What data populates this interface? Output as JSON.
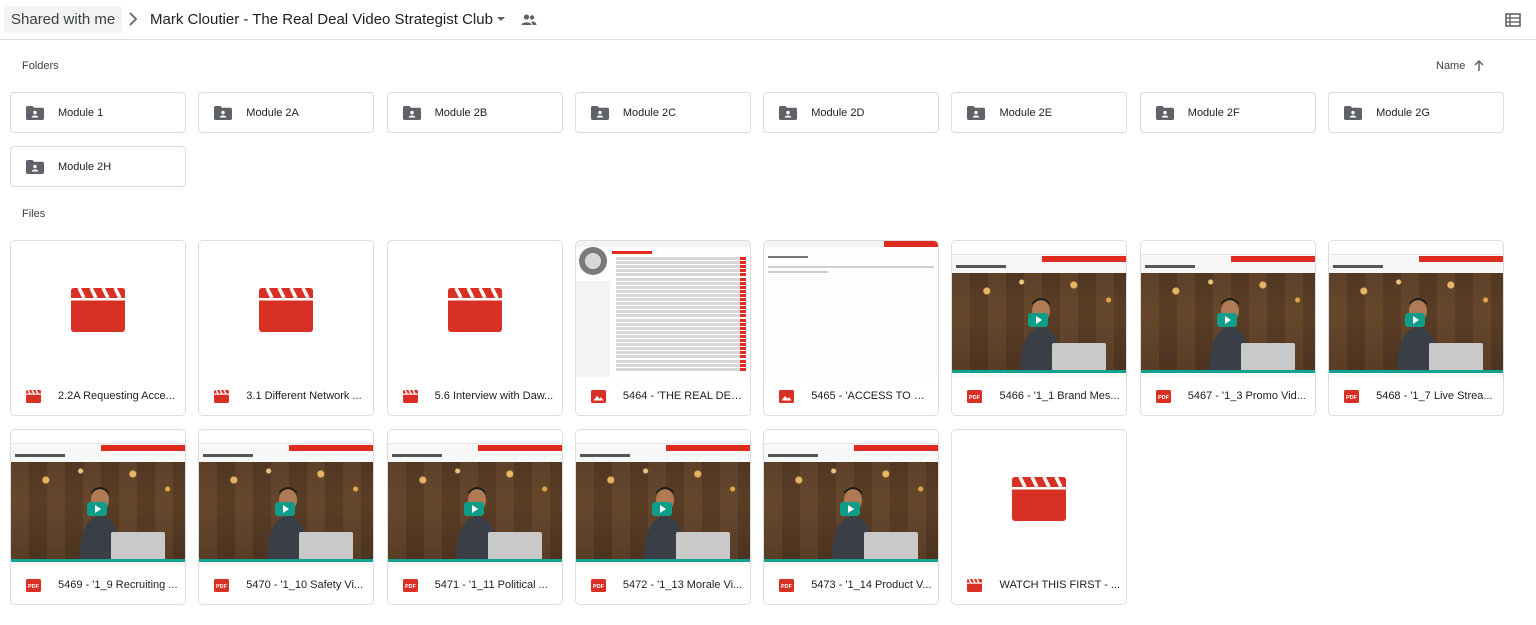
{
  "breadcrumb": {
    "root": "Shared with me",
    "current": "Mark Cloutier - The Real Deal Video Strategist Club"
  },
  "sections": {
    "folders_label": "Folders",
    "files_label": "Files",
    "sort_label": "Name"
  },
  "folders": [
    {
      "name": "Module 1"
    },
    {
      "name": "Module 2A"
    },
    {
      "name": "Module 2B"
    },
    {
      "name": "Module 2C"
    },
    {
      "name": "Module 2D"
    },
    {
      "name": "Module 2E"
    },
    {
      "name": "Module 2F"
    },
    {
      "name": "Module 2G"
    },
    {
      "name": "Module 2H"
    }
  ],
  "files": [
    {
      "name": "2.2A Requesting Acce...",
      "type": "video",
      "thumb": "video-icon"
    },
    {
      "name": "3.1 Different Network ...",
      "type": "video",
      "thumb": "video-icon"
    },
    {
      "name": "5.6 Interview with Daw...",
      "type": "video",
      "thumb": "video-icon"
    },
    {
      "name": "5464 - 'THE REAL DEA...",
      "type": "image",
      "thumb": "doc-list"
    },
    {
      "name": "5465 - 'ACCESS TO OU...",
      "type": "image",
      "thumb": "doc-blank"
    },
    {
      "name": "5466 - '1_1 Brand Mes...",
      "type": "pdf",
      "thumb": "video-page"
    },
    {
      "name": "5467 - '1_3 Promo Vid...",
      "type": "pdf",
      "thumb": "video-page"
    },
    {
      "name": "5468 - '1_7 Live Strea...",
      "type": "pdf",
      "thumb": "video-page"
    },
    {
      "name": "5469 - '1_9 Recruiting ...",
      "type": "pdf",
      "thumb": "video-page"
    },
    {
      "name": "5470 - '1_10 Safety Vi...",
      "type": "pdf",
      "thumb": "video-page"
    },
    {
      "name": "5471 - '1_11 Political ...",
      "type": "pdf",
      "thumb": "video-page"
    },
    {
      "name": "5472 - '1_13 Morale Vi...",
      "type": "pdf",
      "thumb": "video-page"
    },
    {
      "name": "5473 - '1_14 Product V...",
      "type": "pdf",
      "thumb": "video-page"
    },
    {
      "name": "WATCH THIS FIRST - ...",
      "type": "video",
      "thumb": "video-icon"
    }
  ],
  "colors": {
    "accent_red": "#d93025",
    "folder_gray": "#5f6368",
    "border": "#dadce0"
  },
  "icons": {
    "breadcrumb_separator": "chevron-right-icon",
    "dropdown": "caret-down-icon",
    "shared": "people-icon",
    "view_toggle": "list-view-icon",
    "sort": "arrow-up-icon",
    "folder": "shared-folder-icon"
  }
}
